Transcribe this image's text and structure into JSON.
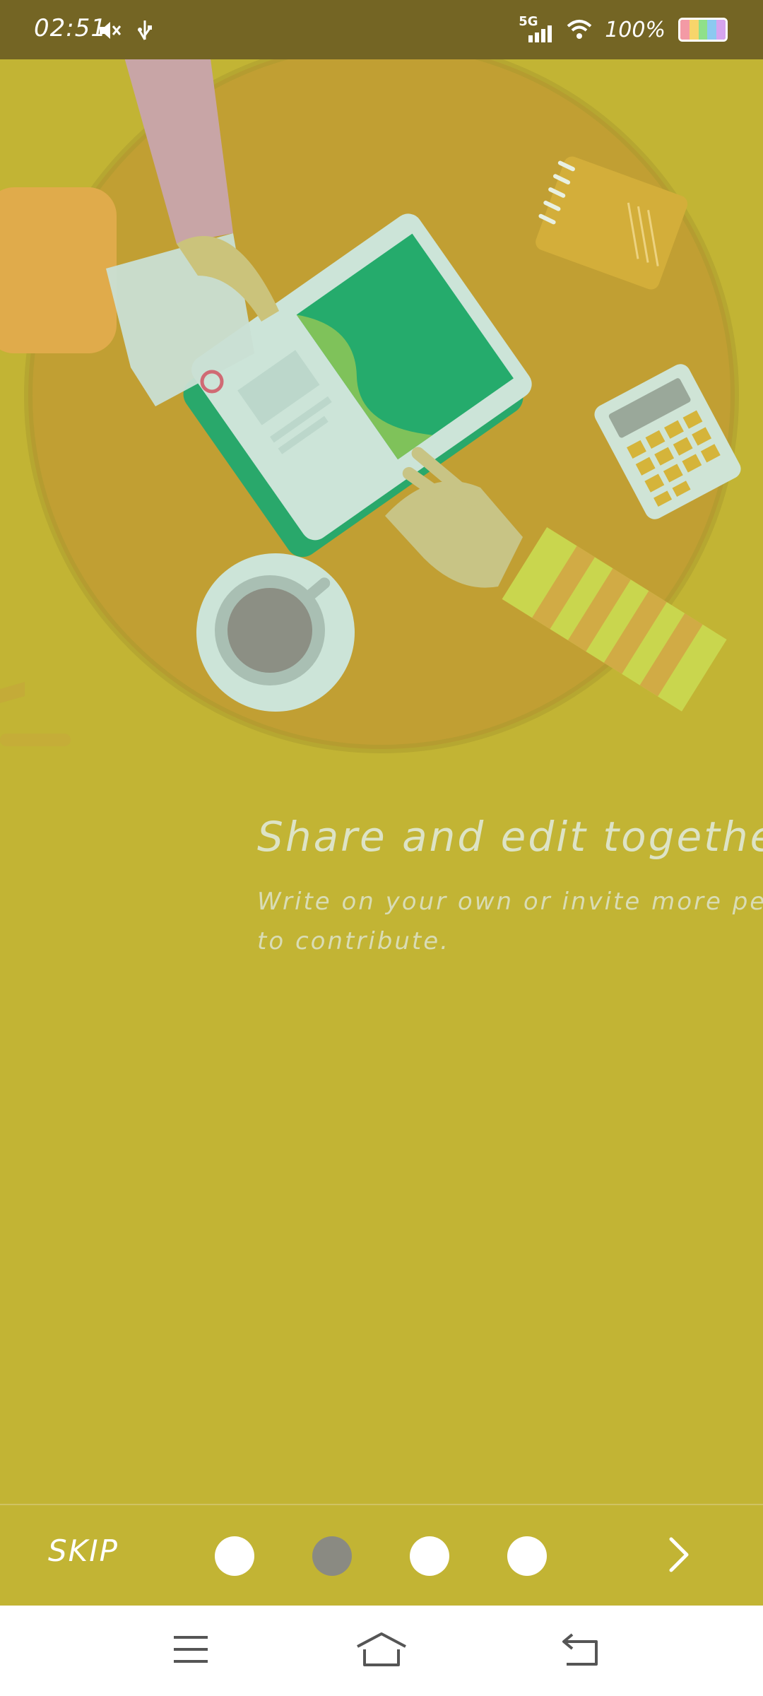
{
  "status_bar": {
    "time": "02:51",
    "network": "5G",
    "battery_text": "100%",
    "icons": [
      "mute-icon",
      "usb-icon",
      "signal-icon",
      "wifi-icon",
      "battery-icon"
    ]
  },
  "onboarding": {
    "title": "Share and edit together",
    "description_line1": "Write on your own or invite more peop",
    "description_line2": "to contribute.",
    "current_page": 2,
    "total_pages": 4
  },
  "controls": {
    "skip_label": "SKIP",
    "next_icon": "chevron-right-icon"
  },
  "nav_bar": {
    "icons": [
      "menu-icon",
      "home-icon",
      "back-icon"
    ]
  },
  "colors": {
    "background": "#c2b434",
    "status_bar": "#746524",
    "active_dot": "#8a8a82"
  }
}
